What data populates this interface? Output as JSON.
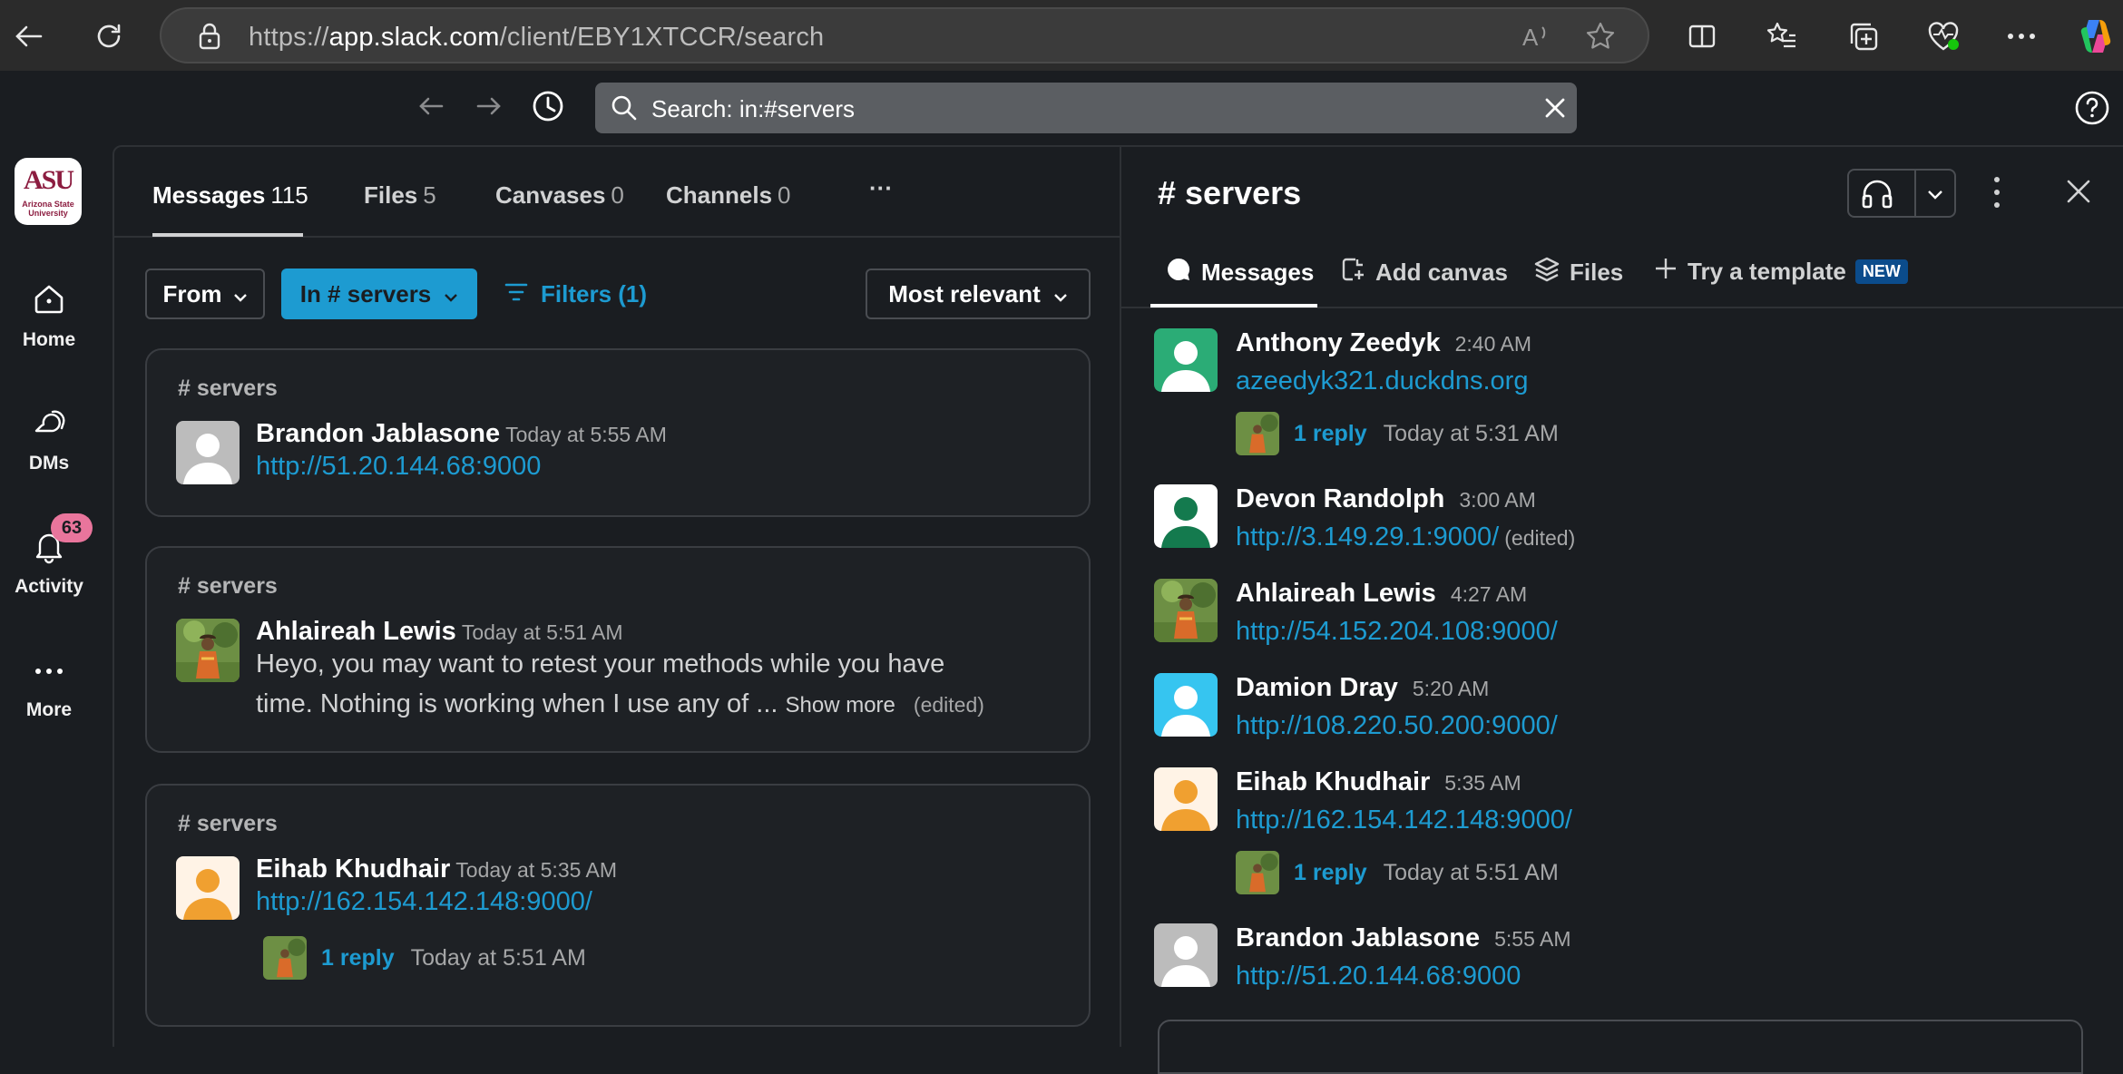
{
  "browser": {
    "url_host": "app.slack.com",
    "url_prefix": "https://",
    "url_path": "/client/EBY1XTCCR/search"
  },
  "slack": {
    "search_text": "Search: in:#servers"
  },
  "rail": {
    "workspace_logo": "ASU",
    "workspace_logo_sub": "Arizona State University",
    "items": [
      {
        "label": "Home",
        "icon": "home-icon"
      },
      {
        "label": "DMs",
        "icon": "dms-icon"
      },
      {
        "label": "Activity",
        "icon": "bell-icon",
        "badge": "63"
      },
      {
        "label": "More",
        "icon": "more-icon"
      }
    ]
  },
  "results": {
    "tabs": [
      {
        "label": "Messages",
        "count": "115"
      },
      {
        "label": "Files",
        "count": "5"
      },
      {
        "label": "Canvases",
        "count": "0"
      },
      {
        "label": "Channels",
        "count": "0"
      }
    ],
    "tabs_more": "···",
    "filters": {
      "from": "From",
      "in_channel": "In # servers",
      "filters": "Filters (1)",
      "sort": "Most relevant"
    },
    "cards": [
      {
        "channel": "# servers",
        "name": "Brandon Jablasone",
        "time": "Today at 5:55 AM",
        "link": "http://51.20.144.68:9000"
      },
      {
        "channel": "# servers",
        "name": "Ahlaireah Lewis",
        "time": "Today at 5:51 AM",
        "line1": "Heyo, you may want to retest your methods while you have",
        "line2": "time. Nothing is working when I use any of ...",
        "show_more": "Show more",
        "edited": "(edited)"
      },
      {
        "channel": "# servers",
        "name": "Eihab Khudhair",
        "time": "Today at 5:35 AM",
        "link": "http://162.154.142.148:9000/",
        "reply": "1 reply",
        "reply_time": "Today at 5:51 AM"
      }
    ]
  },
  "channel": {
    "title": "# servers",
    "tabs": [
      {
        "label": "Messages"
      },
      {
        "label": "Add canvas"
      },
      {
        "label": "Files"
      },
      {
        "label": "Try a template",
        "badge": "NEW"
      }
    ],
    "messages": [
      {
        "name": "Anthony Zeedyk",
        "time": "2:40 AM",
        "link": "azeedyk321.duckdns.org",
        "reply": "1 reply",
        "reply_time": "Today at 5:31 AM",
        "avatar_color": "#2bac76"
      },
      {
        "name": "Devon Randolph",
        "time": "3:00 AM",
        "link": "http://3.149.29.1:9000/",
        "edited": "(edited)",
        "avatar_color": "#ffffff"
      },
      {
        "name": "Ahlaireah Lewis",
        "time": "4:27 AM",
        "link": "http://54.152.204.108:9000/"
      },
      {
        "name": "Damion Dray",
        "time": "5:20 AM",
        "link": "http://108.220.50.200:9000/",
        "avatar_color": "#36c5f0"
      },
      {
        "name": "Eihab Khudhair",
        "time": "5:35 AM",
        "link": "http://162.154.142.148:9000/",
        "reply": "1 reply",
        "reply_time": "Today at 5:51 AM",
        "avatar_color": "#fff3e6"
      },
      {
        "name": "Brandon Jablasone",
        "time": "5:55 AM",
        "link": "http://51.20.144.68:9000",
        "avatar_color": "#bcbcbc"
      }
    ]
  },
  "colors": {
    "link": "#1d9bd1",
    "accent_button": "#1d9bd1",
    "badge": "#e9759c"
  }
}
